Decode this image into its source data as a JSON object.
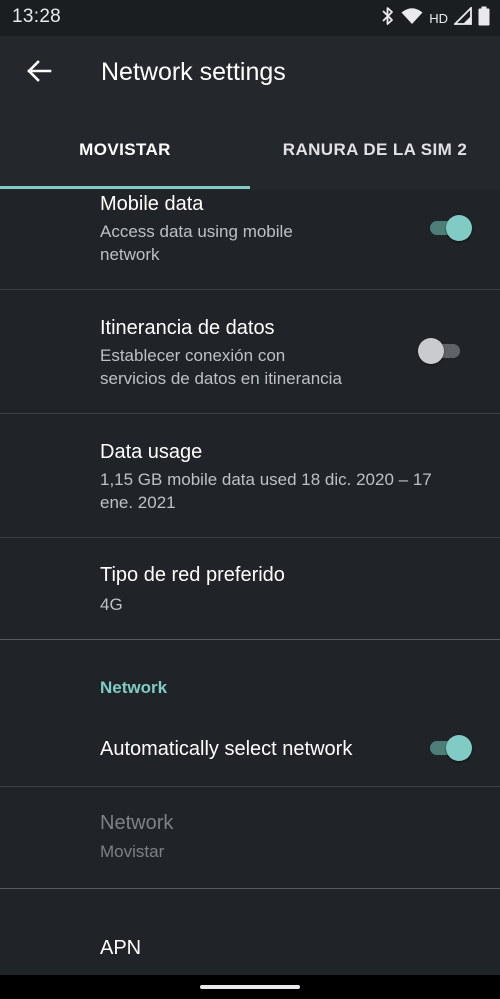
{
  "status_bar": {
    "time": "13:28",
    "network_type": "HD",
    "icons": [
      "bluetooth-icon",
      "wifi-icon",
      "signal-icon",
      "battery-icon"
    ]
  },
  "app_bar": {
    "title": "Network settings",
    "back_icon": "arrow-back-icon"
  },
  "tabs": [
    {
      "label": "MOVISTAR",
      "selected": true
    },
    {
      "label": "RANURA DE LA SIM 2",
      "selected": false
    }
  ],
  "settings": {
    "mobile_data": {
      "title": "Mobile data",
      "subtitle_line1": "Access data using mobile",
      "subtitle_line2": "network",
      "enabled": true
    },
    "roaming": {
      "title": "Itinerancia de datos",
      "subtitle_line1": "Establecer conexión con",
      "subtitle_line2": "servicios de datos en itinerancia",
      "enabled": false
    },
    "data_usage": {
      "title": "Data usage",
      "subtitle_line1": "1,15 GB mobile data used 18 dic. 2020 – 17",
      "subtitle_line2": "ene. 2021"
    },
    "preferred_network": {
      "title": "Tipo de red preferido",
      "value": "4G"
    },
    "network_section": {
      "header": "Network",
      "auto_select": {
        "title": "Automatically select network",
        "enabled": true
      },
      "network": {
        "title": "Network",
        "value": "Movistar",
        "disabled": true
      }
    },
    "apn": {
      "title": "APN"
    }
  },
  "colors": {
    "background": "#202327",
    "accent": "#80cbc4",
    "switch_on_track": "#4f7e79",
    "switch_off_thumb": "#c9cbce",
    "secondary_text": "#bdc1c6",
    "disabled_text": "#7d8186"
  }
}
